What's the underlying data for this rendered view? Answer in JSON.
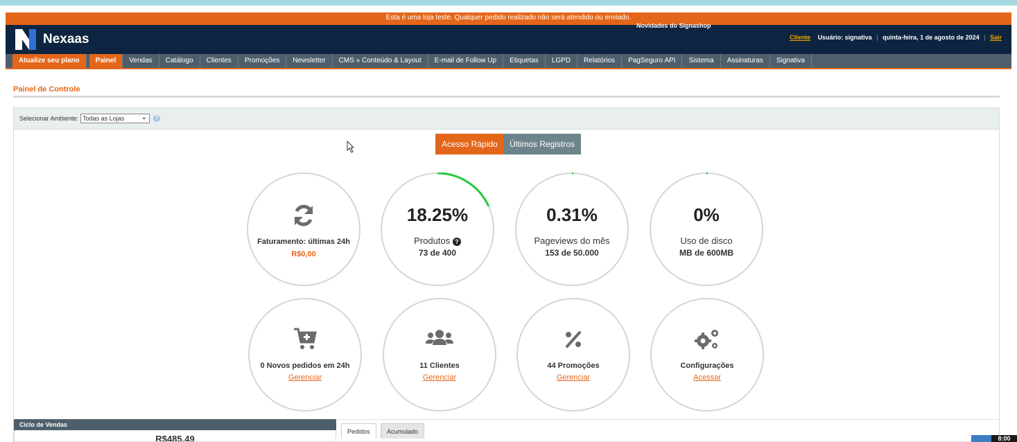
{
  "notice": "Esta é uma loja teste. Qualquer pedido realizado não será atendido ou enviado.",
  "novidades": "Novidades do Signashop",
  "brand": {
    "name": "Nexaas"
  },
  "user": {
    "client_link": "Cliente",
    "user_label": "Usuário: signativa",
    "date": "quinta-feira, 1 de agosto de 2024",
    "logout": "Sair"
  },
  "nav": [
    "Atualize seu plano",
    "Painel",
    "Vendas",
    "Catálogo",
    "Clientes",
    "Promoções",
    "Newsletter",
    "CMS » Conteúdo & Layout",
    "E-mail de Follow Up",
    "Etiquetas",
    "LGPD",
    "Relatórios",
    "PagSeguro API",
    "Sistema",
    "Assinaturas",
    "Signativa"
  ],
  "page_title": "Painel de Controle",
  "env": {
    "label": "Selecionar Ambiente:",
    "selected": "Todas as Lojas"
  },
  "tabs": {
    "quick": "Acesso Rápido",
    "last": "Últimos Registros"
  },
  "stats": {
    "billing": {
      "label": "Faturamento: últimas 24h",
      "value": "R$0,00"
    },
    "products": {
      "percent": "18.25%",
      "label": "Produtos",
      "sub": "73 de 400",
      "fraction": 0.1825
    },
    "pageviews": {
      "percent": "0.31%",
      "label": "Pageviews do mês",
      "sub": "153 de 50.000",
      "fraction": 0.0031
    },
    "disk": {
      "percent": "0%",
      "label": "Uso de disco",
      "sub": "MB de 600MB",
      "fraction": 0.0
    }
  },
  "shortcuts": {
    "orders": {
      "label": "0 Novos pedidos em 24h",
      "link": "Gerenciar"
    },
    "clients": {
      "label": "11 Clientes",
      "link": "Gerenciar"
    },
    "promos": {
      "label": "44 Promoções",
      "link": "Gerenciar"
    },
    "config": {
      "label": "Configurações",
      "link": "Acessar"
    }
  },
  "ciclo": {
    "title": "Ciclo de Vendas",
    "value": "R$485,49"
  },
  "bottom_tabs": [
    "Pedidos",
    "Acumulado"
  ],
  "clock": "8:00",
  "colors": {
    "accent": "#e4661a",
    "header": "#0e2541",
    "nav": "#4e5f6c",
    "progress": "#22c93a"
  }
}
